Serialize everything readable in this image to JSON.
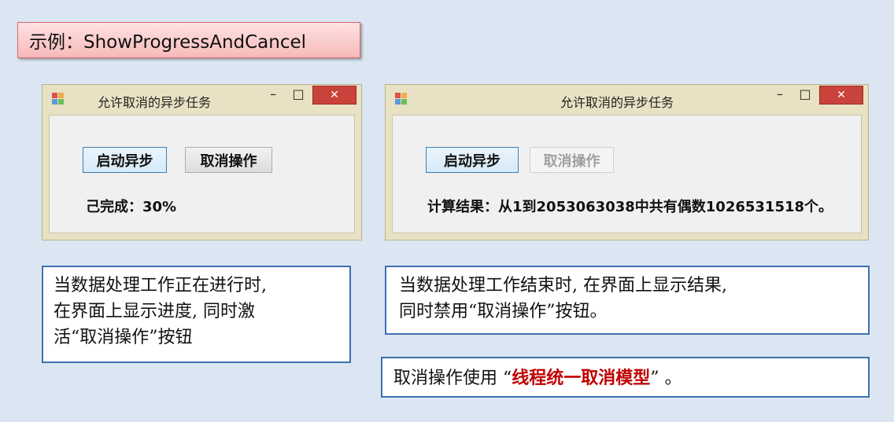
{
  "banner": {
    "title": "示例：ShowProgressAndCancel"
  },
  "window_left": {
    "title": "允许取消的异步任务",
    "minimize_glyph": "–",
    "maximize_glyph": "□",
    "close_glyph": "✕",
    "start_button": "启动异步",
    "cancel_button": "取消操作",
    "status": "己完成：30%"
  },
  "window_right": {
    "title": "允许取消的异步任务",
    "minimize_glyph": "–",
    "maximize_glyph": "□",
    "close_glyph": "✕",
    "start_button": "启动异步",
    "cancel_button": "取消操作",
    "cancel_disabled": true,
    "status": "计算结果：从1到2053063038中共有偶数1026531518个。"
  },
  "callout_left": {
    "lines": [
      "当数据处理工作正在进行时,",
      "在界面上显示进度, 同时激",
      "活“取消操作”按钮"
    ]
  },
  "callout_right": {
    "lines": [
      "当数据处理工作结束时, 在界面上显示结果,",
      "同时禁用“取消操作”按钮。"
    ]
  },
  "callout_bottom": {
    "prefix": "取消操作使用 “",
    "highlight": "线程统一取消模型",
    "suffix": "” 。",
    "highlight_color": "#c00000"
  },
  "colors": {
    "background": "#dce6f2",
    "banner": "#f8b9b9",
    "callout_border": "#3e6fb0",
    "close_button": "#c9433a"
  }
}
